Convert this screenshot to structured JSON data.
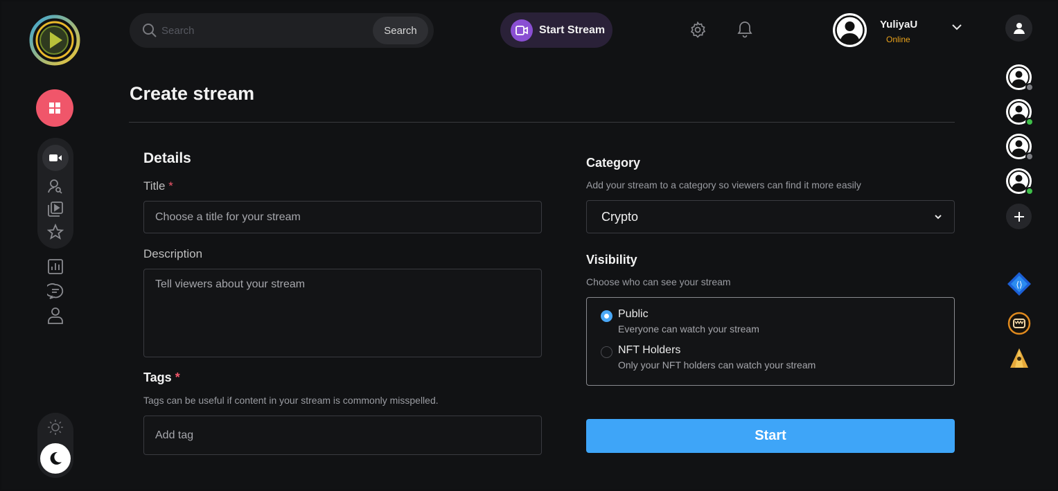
{
  "header": {
    "search_placeholder": "Search",
    "search_button": "Search",
    "start_stream_label": "Start Stream",
    "user": {
      "name": "YuliyaU",
      "status": "Online"
    }
  },
  "page": {
    "title": "Create stream"
  },
  "details": {
    "heading": "Details",
    "title_label": "Title",
    "title_required": "*",
    "title_placeholder": "Choose a title for your stream",
    "description_label": "Description",
    "description_placeholder": "Tell viewers about your stream",
    "tags_label": "Tags",
    "tags_required": "*",
    "tags_help": "Tags can be useful if content in your stream is commonly misspelled.",
    "tags_placeholder": "Add tag"
  },
  "category": {
    "heading": "Category",
    "help": "Add your stream to a category so viewers can find it more easily",
    "selected": "Crypto"
  },
  "visibility": {
    "heading": "Visibility",
    "help": "Choose who can see your stream",
    "options": [
      {
        "title": "Public",
        "desc": "Everyone can watch your stream",
        "selected": true
      },
      {
        "title": "NFT Holders",
        "desc": "Only your NFT holders can watch your stream",
        "selected": false
      }
    ]
  },
  "start_button": "Start",
  "colors": {
    "accent": "#3ea5f8",
    "home": "#f0566a",
    "stream_purple": "#8a4fd3",
    "online": "#e8a11b",
    "status_online_dot": "#3fbf4a",
    "status_offline_dot": "#7a7b80"
  },
  "right_rail": {
    "friends": [
      {
        "status": "offline"
      },
      {
        "status": "online"
      },
      {
        "status": "offline"
      },
      {
        "status": "online"
      }
    ]
  }
}
